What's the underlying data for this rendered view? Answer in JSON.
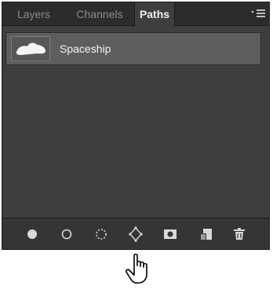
{
  "tabs": [
    {
      "label": "Layers",
      "active": false
    },
    {
      "label": "Channels",
      "active": false
    },
    {
      "label": "Paths",
      "active": true
    }
  ],
  "menu_icon": "panel-menu-icon",
  "paths": [
    {
      "name": "Spaceship",
      "thumbnail_icon": "spaceship-shape-icon",
      "selected": true
    }
  ],
  "toolbar_icons": [
    "fill-path-icon",
    "stroke-path-icon",
    "load-selection-icon",
    "make-work-path-icon",
    "add-mask-icon",
    "new-path-icon",
    "trash-icon"
  ],
  "cursor_icon": "hand-pointer-icon",
  "colors": {
    "panel_bg": "#3e3e3e",
    "tabbar_bg": "#2c2c2c",
    "selected_row": "#5e5e5e",
    "toolbar_bg": "#353535",
    "icon": "#d8d8d8"
  }
}
